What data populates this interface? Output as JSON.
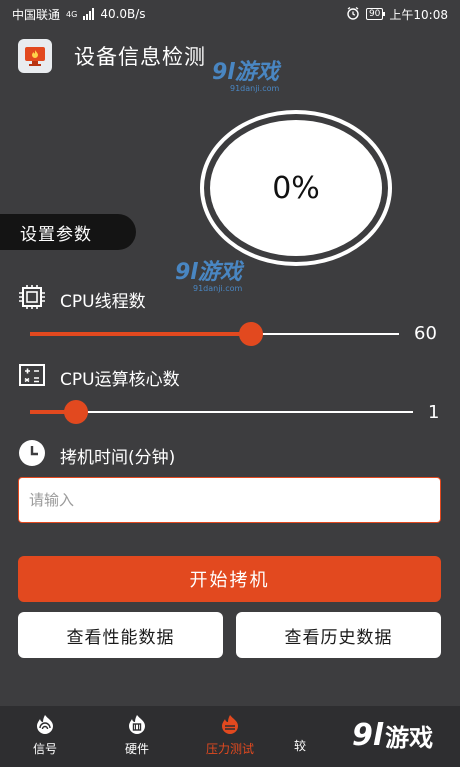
{
  "status_bar": {
    "carrier": "中国联通",
    "network": "4G",
    "speed": "40.0B/s",
    "battery": "90",
    "time": "上午10:08"
  },
  "header": {
    "title": "设备信息检测"
  },
  "watermark": {
    "main": "9l游戏",
    "sub": "91danji.com"
  },
  "gauge": {
    "value_text": "0%"
  },
  "section": {
    "title": "设置参数"
  },
  "params": {
    "cpu_threads": {
      "label": "CPU线程数",
      "value": 60,
      "display": "60",
      "fraction": 0.6
    },
    "cpu_cores": {
      "label": "CPU运算核心数",
      "value": 1,
      "display": "1",
      "fraction": 0.12
    },
    "duration": {
      "label": "拷机时间(分钟)",
      "placeholder": "请输入"
    }
  },
  "buttons": {
    "start": "开始拷机",
    "view_performance": "查看性能数据",
    "view_history": "查看历史数据"
  },
  "nav": {
    "items": [
      {
        "label": "信号",
        "icon": "signal-flame-icon",
        "active": false
      },
      {
        "label": "硬件",
        "icon": "chip-flame-icon",
        "active": false
      },
      {
        "label": "压力测试",
        "icon": "pressure-flame-icon",
        "active": true
      },
      {
        "label": "较",
        "icon": "compare-icon",
        "active": false
      }
    ]
  },
  "brand_watermark": {
    "num": "9l",
    "text": "游戏"
  },
  "colors": {
    "accent": "#e2491f",
    "background": "#3d3d3f",
    "tag_background": "#141414",
    "watermark": "#4c93d9"
  }
}
